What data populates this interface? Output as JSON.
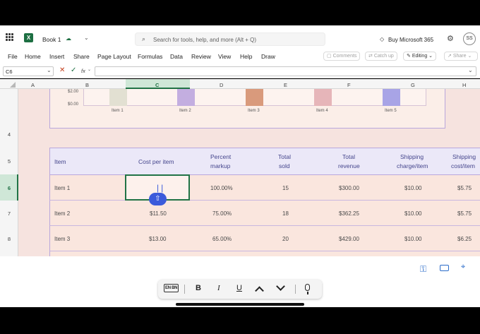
{
  "app": {
    "book_title": "Book 1",
    "search_placeholder": "Search for tools, help, and more (Alt + Q)",
    "buy_label": "Buy Microsoft 365",
    "avatar_initials": "SS"
  },
  "menu": {
    "items": [
      "File",
      "Home",
      "Insert",
      "Share",
      "Page Layout",
      "Formulas",
      "Data",
      "Review",
      "View",
      "Help",
      "Draw"
    ],
    "comments": "Comments",
    "catchup": "Catch up",
    "editing": "Editing",
    "share": "Share"
  },
  "formula": {
    "cell_ref": "C6",
    "fx": "fx",
    "value": ""
  },
  "columns": [
    "A",
    "B",
    "C",
    "D",
    "E",
    "F",
    "G",
    "H"
  ],
  "rows": [
    "4",
    "5",
    "6",
    "7",
    "8"
  ],
  "chart": {
    "y_labels": [
      "$2.00",
      "$0.00"
    ],
    "x_labels": [
      "Item 1",
      "Item 2",
      "Item 3",
      "Item 4",
      "Item 5"
    ],
    "bar_colors": [
      "#e2e0d2",
      "#c3aee0",
      "#d99a7c",
      "#e6b5b9",
      "#a8a4e6"
    ]
  },
  "table": {
    "headers": {
      "item": "Item",
      "cost": "Cost per item",
      "markup": [
        "Percent",
        "markup"
      ],
      "sold": [
        "Total",
        "sold"
      ],
      "revenue": [
        "Total",
        "revenue"
      ],
      "shipping": [
        "Shipping",
        "charge/item"
      ],
      "ship_cost": [
        "Shipping",
        "cost/item"
      ]
    },
    "rows": [
      {
        "item": "Item 1",
        "cost": "",
        "markup": "100.00%",
        "sold": "15",
        "revenue": "$300.00",
        "shipping": "$10.00",
        "ship_cost": "$5.75"
      },
      {
        "item": "Item 2",
        "cost": "$11.50",
        "markup": "75.00%",
        "sold": "18",
        "revenue": "$362.25",
        "shipping": "$10.00",
        "ship_cost": "$5.75"
      },
      {
        "item": "Item 3",
        "cost": "$13.00",
        "markup": "65.00%",
        "sold": "20",
        "revenue": "$429.00",
        "shipping": "$10.00",
        "ship_cost": "$6.25"
      }
    ]
  },
  "keyboard": {
    "lang": "EN BN",
    "bold": "B",
    "italic": "I",
    "underline": "U",
    "up": "^",
    "down": "v"
  },
  "colors": {
    "accent": "#217346",
    "header_fill": "#ebe8f8",
    "row_fill": "#fae6de",
    "select_blue": "#3b5bdb"
  }
}
